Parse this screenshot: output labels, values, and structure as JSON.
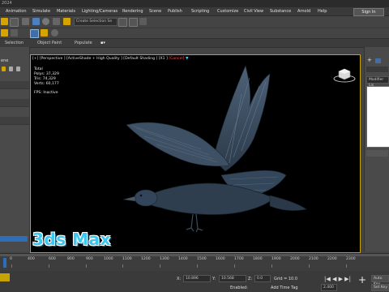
{
  "app": {
    "title_fragment": "2024"
  },
  "menubar": {
    "items": [
      "Animation",
      "Simulate",
      "Materials",
      "Lighting/Cameras",
      "Rendering",
      "Scene",
      "Publish",
      "Scripting",
      "Customize",
      "Civil View",
      "Substance",
      "Arnold",
      "Help"
    ],
    "signin_label": "Sign In"
  },
  "toolbar": {
    "selection_set_placeholder": "Create Selection Se"
  },
  "ribbon": {
    "items": [
      "Selection",
      "Object Paint",
      "Populate"
    ]
  },
  "left_panel": {
    "label": "ene"
  },
  "viewport": {
    "label_main": "[+] [Perspective ] [ActiveShade + High Quality ] [Default Shading ] [X1 ]",
    "label_cancel": "[Cancel]",
    "stats": {
      "total": "Total",
      "polys": "Polys:  37,329",
      "tris": "Tris:   74,329",
      "verts": "Verts:  60,177",
      "fps": "FPS:    Inactive"
    }
  },
  "right_panel": {
    "field_label": "Modifier Lis"
  },
  "timeline": {
    "ticks": [
      "0",
      "400",
      "600",
      "800",
      "900",
      "1000",
      "1100",
      "1200",
      "1300",
      "1400",
      "1500",
      "1600",
      "1700",
      "1800",
      "1900",
      "2000",
      "2100",
      "2200",
      "2300"
    ],
    "progress_label": "0 / 2400"
  },
  "status": {
    "x_label": "X:",
    "x_value": "10.896",
    "y_label": "Y:",
    "y_value": "10.568",
    "z_label": "Z:",
    "z_value": "0.0",
    "grid_label": "Grid = 10.0",
    "enabled_label": "Enabled:",
    "add_time_tag": "Add Time Tag",
    "auto_key": "Auto Key",
    "set_key": "Set Key",
    "frame_value": "2.400",
    "selected_label": "Selected"
  },
  "watermark": "3ds Max",
  "colors": {
    "viewport_border": "#c8a200",
    "accent": "#3cc6f0",
    "cancel": "#ff4d4d"
  }
}
